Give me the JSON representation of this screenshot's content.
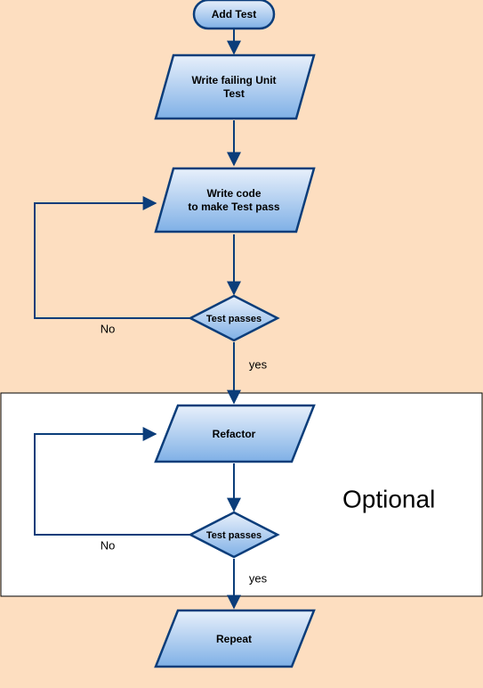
{
  "nodes": {
    "start": "Add Test",
    "write_failing": "Write failing Unit Test",
    "write_code_l1": "Write code",
    "write_code_l2": "to make Test pass",
    "test_passes_1": "Test passes",
    "refactor": "Refactor",
    "test_passes_2": "Test passes",
    "repeat": "Repeat"
  },
  "edges": {
    "no1": "No",
    "yes1": "yes",
    "no2": "No",
    "yes2": "yes"
  },
  "region": {
    "optional": "Optional"
  }
}
